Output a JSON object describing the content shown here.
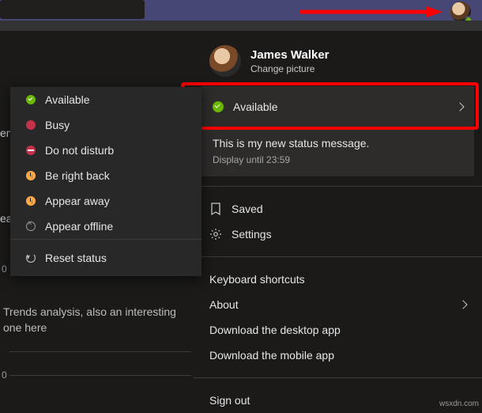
{
  "user": {
    "name": "James Walker",
    "change_picture_label": "Change picture"
  },
  "status": {
    "current": "Available",
    "message": "This is my new status message.",
    "display_until": "Display until 23:59",
    "options": [
      {
        "key": "available",
        "label": "Available"
      },
      {
        "key": "busy",
        "label": "Busy"
      },
      {
        "key": "dnd",
        "label": "Do not disturb"
      },
      {
        "key": "brb",
        "label": "Be right back"
      },
      {
        "key": "away",
        "label": "Appear away"
      },
      {
        "key": "offline",
        "label": "Appear offline"
      }
    ],
    "reset_label": "Reset status"
  },
  "menu": {
    "saved": "Saved",
    "settings": "Settings",
    "keyboard_shortcuts": "Keyboard shortcuts",
    "about": "About",
    "download_desktop": "Download the desktop app",
    "download_mobile": "Download the mobile app",
    "sign_out": "Sign out"
  },
  "background": {
    "snippet": "Trends analysis, also an interesting one here",
    "truncated_label_1": "en",
    "truncated_label_2": "ea",
    "axis_tick_1": "0",
    "axis_tick_2": "0"
  },
  "watermark": "wsxdn.com"
}
